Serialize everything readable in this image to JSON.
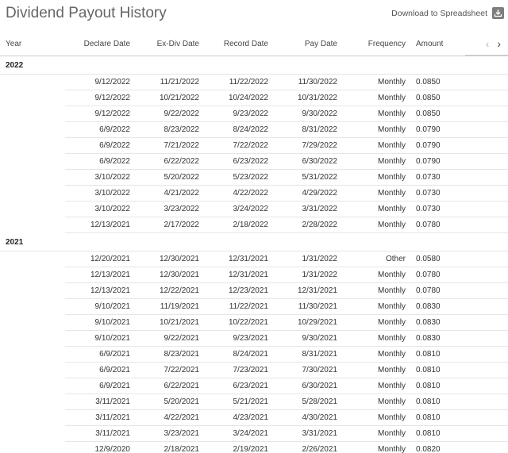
{
  "title": "Dividend Payout History",
  "download_label": "Download to Spreadsheet",
  "columns": {
    "year": "Year",
    "declare": "Declare Date",
    "exdiv": "Ex-Div Date",
    "record": "Record Date",
    "pay": "Pay Date",
    "frequency": "Frequency",
    "amount": "Amount"
  },
  "groups": [
    {
      "year": "2022",
      "rows": [
        [
          "9/12/2022",
          "11/21/2022",
          "11/22/2022",
          "11/30/2022",
          "Monthly",
          "0.0850"
        ],
        [
          "9/12/2022",
          "10/21/2022",
          "10/24/2022",
          "10/31/2022",
          "Monthly",
          "0.0850"
        ],
        [
          "9/12/2022",
          "9/22/2022",
          "9/23/2022",
          "9/30/2022",
          "Monthly",
          "0.0850"
        ],
        [
          "6/9/2022",
          "8/23/2022",
          "8/24/2022",
          "8/31/2022",
          "Monthly",
          "0.0790"
        ],
        [
          "6/9/2022",
          "7/21/2022",
          "7/22/2022",
          "7/29/2022",
          "Monthly",
          "0.0790"
        ],
        [
          "6/9/2022",
          "6/22/2022",
          "6/23/2022",
          "6/30/2022",
          "Monthly",
          "0.0790"
        ],
        [
          "3/10/2022",
          "5/20/2022",
          "5/23/2022",
          "5/31/2022",
          "Monthly",
          "0.0730"
        ],
        [
          "3/10/2022",
          "4/21/2022",
          "4/22/2022",
          "4/29/2022",
          "Monthly",
          "0.0730"
        ],
        [
          "3/10/2022",
          "3/23/2022",
          "3/24/2022",
          "3/31/2022",
          "Monthly",
          "0.0730"
        ],
        [
          "12/13/2021",
          "2/17/2022",
          "2/18/2022",
          "2/28/2022",
          "Monthly",
          "0.0780"
        ]
      ]
    },
    {
      "year": "2021",
      "rows": [
        [
          "12/20/2021",
          "12/30/2021",
          "12/31/2021",
          "1/31/2022",
          "Other",
          "0.0580"
        ],
        [
          "12/13/2021",
          "12/30/2021",
          "12/31/2021",
          "1/31/2022",
          "Monthly",
          "0.0780"
        ],
        [
          "12/13/2021",
          "12/22/2021",
          "12/23/2021",
          "12/31/2021",
          "Monthly",
          "0.0780"
        ],
        [
          "9/10/2021",
          "11/19/2021",
          "11/22/2021",
          "11/30/2021",
          "Monthly",
          "0.0830"
        ],
        [
          "9/10/2021",
          "10/21/2021",
          "10/22/2021",
          "10/29/2021",
          "Monthly",
          "0.0830"
        ],
        [
          "9/10/2021",
          "9/22/2021",
          "9/23/2021",
          "9/30/2021",
          "Monthly",
          "0.0830"
        ],
        [
          "6/9/2021",
          "8/23/2021",
          "8/24/2021",
          "8/31/2021",
          "Monthly",
          "0.0810"
        ],
        [
          "6/9/2021",
          "7/22/2021",
          "7/23/2021",
          "7/30/2021",
          "Monthly",
          "0.0810"
        ],
        [
          "6/9/2021",
          "6/22/2021",
          "6/23/2021",
          "6/30/2021",
          "Monthly",
          "0.0810"
        ],
        [
          "3/11/2021",
          "5/20/2021",
          "5/21/2021",
          "5/28/2021",
          "Monthly",
          "0.0810"
        ],
        [
          "3/11/2021",
          "4/22/2021",
          "4/23/2021",
          "4/30/2021",
          "Monthly",
          "0.0810"
        ],
        [
          "3/11/2021",
          "3/23/2021",
          "3/24/2021",
          "3/31/2021",
          "Monthly",
          "0.0810"
        ],
        [
          "12/9/2020",
          "2/18/2021",
          "2/19/2021",
          "2/26/2021",
          "Monthly",
          "0.0820"
        ]
      ]
    }
  ],
  "icons": {
    "download": "download-icon",
    "prev": "chevron-left-icon",
    "next": "chevron-right-icon"
  },
  "nav": {
    "prev_glyph": "‹",
    "next_glyph": "›"
  }
}
